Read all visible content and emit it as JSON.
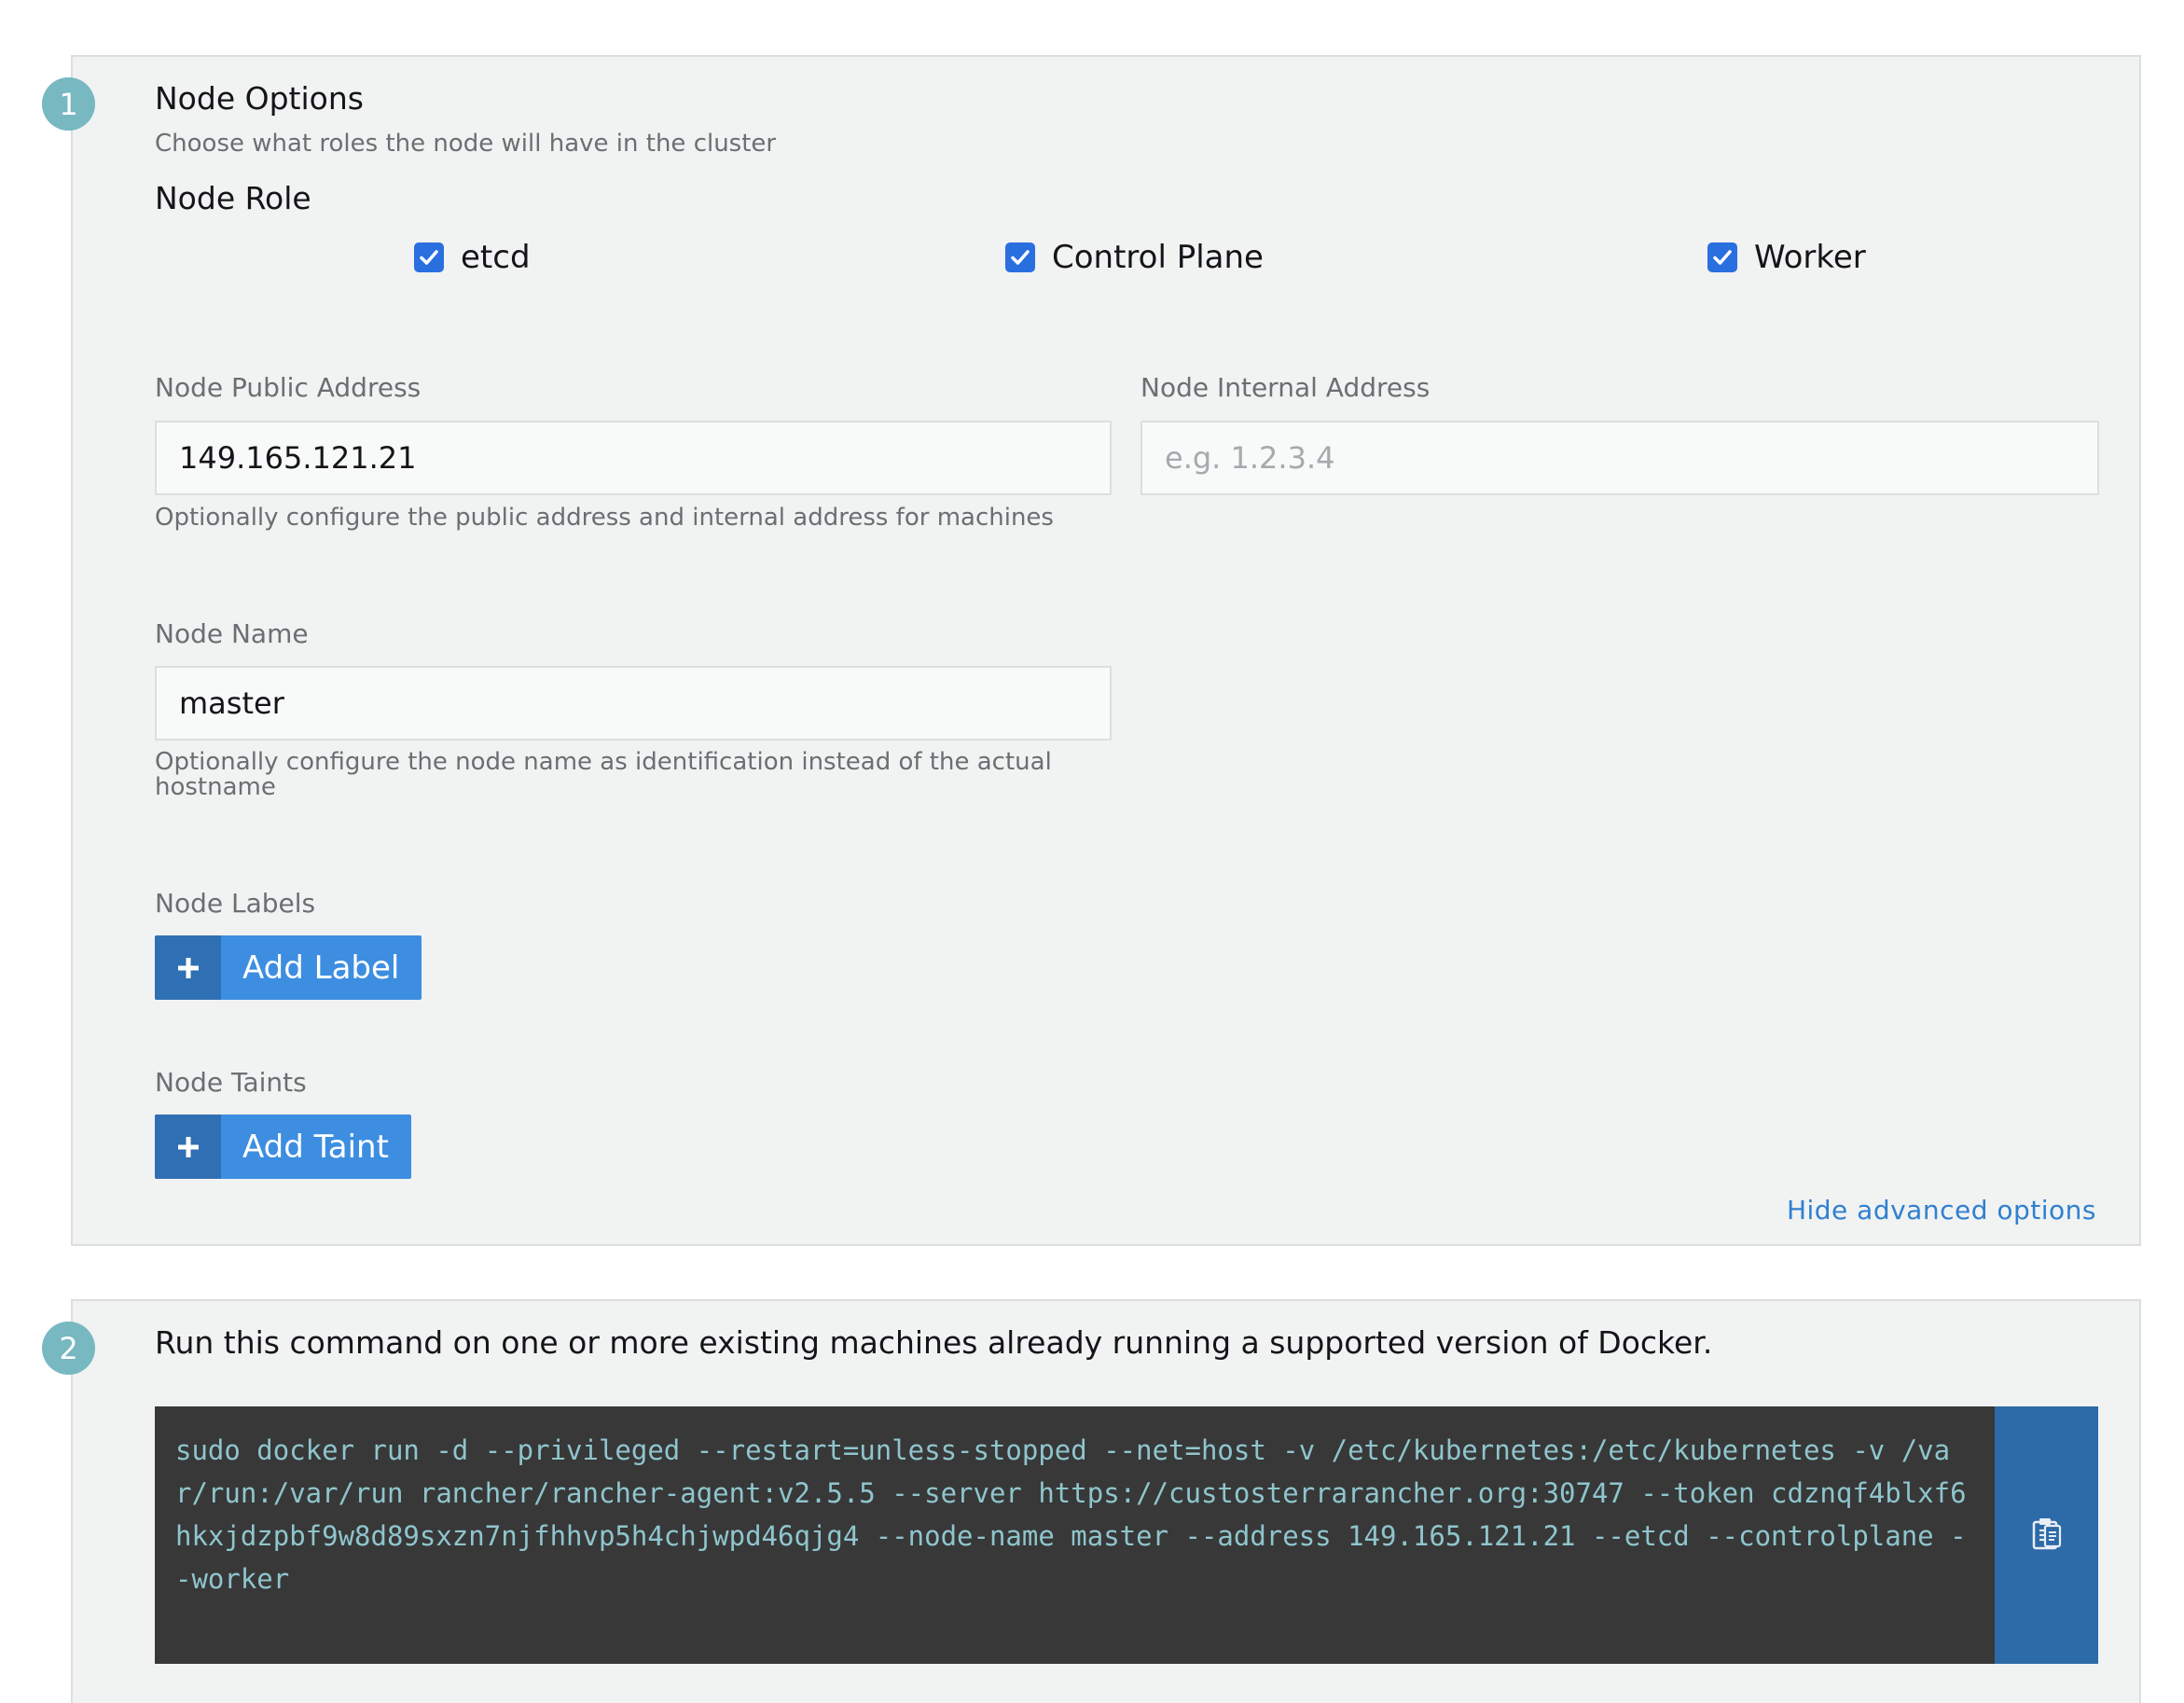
{
  "step1": {
    "number": "1",
    "title": "Node Options",
    "subtitle": "Choose what roles the node will have in the cluster",
    "role_heading": "Node Role",
    "roles": [
      {
        "label": "etcd",
        "checked": true
      },
      {
        "label": "Control Plane",
        "checked": true
      },
      {
        "label": "Worker",
        "checked": true
      }
    ],
    "public_address": {
      "label": "Node Public Address",
      "value": "149.165.121.21"
    },
    "internal_address": {
      "label": "Node Internal Address",
      "placeholder": "e.g. 1.2.3.4"
    },
    "address_help": "Optionally configure the public address and internal address for machines",
    "node_name": {
      "label": "Node Name",
      "value": "master",
      "help": "Optionally configure the node name as identification instead of the actual hostname"
    },
    "labels": {
      "label": "Node Labels",
      "button": "Add Label"
    },
    "taints": {
      "label": "Node Taints",
      "button": "Add Taint"
    },
    "advanced_link": "Hide advanced options"
  },
  "step2": {
    "number": "2",
    "instruction": "Run this command on one or more existing machines already running a supported version of Docker.",
    "command": "sudo docker run -d --privileged --restart=unless-stopped --net=host -v /etc/kubernetes:/etc/kubernetes -v /var/run:/var/run rancher/rancher-agent:v2.5.5 --server https://custosterrarancher.org:30747 --token cdznqf4blxf6hkxjdzpbf9w8d89sxzn7njfhhvp5h4chjwpd46qjg4 --node-name master --address 149.165.121.21 --etcd --controlplane --worker",
    "copy_icon": "clipboard-icon"
  },
  "colors": {
    "accent": "#3d8ee1",
    "step_circle": "#77b8c1",
    "checkbox": "#2a6fe0",
    "code_bg": "#383838",
    "code_text": "#8fc5cd"
  }
}
